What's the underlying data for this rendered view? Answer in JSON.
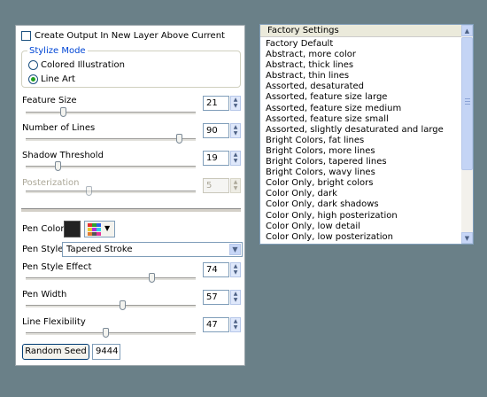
{
  "panel": {
    "create_output_label": "Create Output In New Layer Above Current",
    "create_output_checked": false,
    "stylize_mode": {
      "title": "Stylize Mode",
      "options": [
        {
          "label": "Colored Illustration",
          "selected": false
        },
        {
          "label": "Line Art",
          "selected": true
        }
      ]
    },
    "sliders": [
      {
        "label": "Feature Size",
        "value": "21",
        "fraction": 0.22
      },
      {
        "label": "Number of Lines",
        "value": "90",
        "fraction": 0.9
      },
      {
        "label": "Shadow Threshold",
        "value": "19",
        "fraction": 0.19
      },
      {
        "label": "Posterization",
        "value": "5",
        "fraction": 0.37,
        "disabled": true
      }
    ],
    "pen_color": {
      "label": "Pen Color",
      "swatch": "#222222"
    },
    "pen_style": {
      "label": "Pen Style:",
      "value": "Tapered Stroke"
    },
    "pen_sliders": [
      {
        "label": "Pen Style Effect",
        "value": "74",
        "fraction": 0.74
      },
      {
        "label": "Pen Width",
        "value": "57",
        "fraction": 0.57
      },
      {
        "label": "Line Flexibility",
        "value": "47",
        "fraction": 0.47
      }
    ],
    "random_seed": {
      "button_label": "Random Seed",
      "value": "9444"
    }
  },
  "factory": {
    "header": "Factory Settings",
    "items": [
      "Factory Default",
      "Abstract, more color",
      "Abstract, thick lines",
      "Abstract, thin lines",
      "Assorted, desaturated",
      "Assorted, feature size large",
      "Assorted, feature size medium",
      "Assorted, feature size small",
      "Assorted, slightly desaturated and large",
      "Bright Colors, fat lines",
      "Bright Colors, more lines",
      "Bright Colors, tapered lines",
      "Bright Colors, wavy lines",
      "Color Only, bright colors",
      "Color Only, dark",
      "Color Only, dark shadows",
      "Color Only, high posterization",
      "Color Only, low detail",
      "Color Only, low posterization"
    ]
  },
  "colors": {
    "background": "#6a8088",
    "accent_blue": "#0046d5",
    "radio_dot": "#21a121"
  }
}
